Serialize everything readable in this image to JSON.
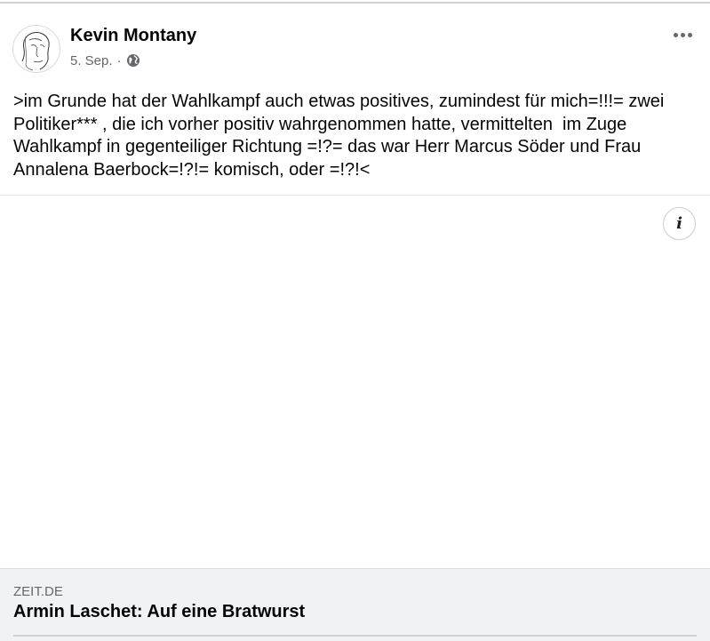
{
  "post": {
    "author": "Kevin Montany",
    "date": "5. Sep.",
    "separator": "·",
    "audience_icon": "globe-icon",
    "text": ">im Grunde hat der Wahlkampf auch etwas positives, zumindest für mich=!!!= zwei Politiker*** , die ich vorher positiv wahrgenommen hatte, vermittelten  im Zuge Wahlkampf in gegenteiliger Richtung =!?= das war Herr Marcus Söder und Frau Annalena Baerbock=!?!= komisch, oder =!?!<"
  },
  "media": {
    "info_icon": "info-icon",
    "info_glyph": "i"
  },
  "link_preview": {
    "domain": "ZEIT.DE",
    "title": "Armin Laschet: Auf eine Bratwurst"
  },
  "colors": {
    "text_primary": "#050505",
    "text_secondary": "#65676b",
    "preview_bg": "#f0f2f5",
    "divider": "#e4e6eb"
  }
}
